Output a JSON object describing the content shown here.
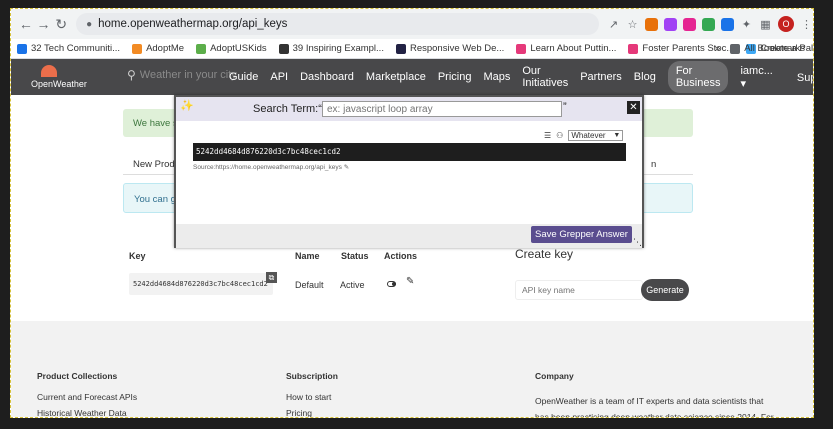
{
  "browser": {
    "url": "home.openweathermap.org/api_keys",
    "bookmarks": [
      {
        "label": "32 Tech Communiti...",
        "color": "#1a73e8"
      },
      {
        "label": "AdoptMe",
        "color": "#f28b24"
      },
      {
        "label": "AdoptUSKids",
        "color": "#5cae4a"
      },
      {
        "label": "39 Inspiring Exampl...",
        "color": "#333333"
      },
      {
        "label": "Responsive Web De...",
        "color": "#222244"
      },
      {
        "label": "Learn About Puttin...",
        "color": "#e5397a"
      },
      {
        "label": "Foster Parents Stoc...",
        "color": "#e5397a"
      },
      {
        "label": "Create a Palette - C...",
        "color": "#3da8f5"
      }
    ],
    "all_bookmarks": "All Bookmarks",
    "avatar_letter": "O"
  },
  "ow": {
    "logo": "OpenWeather",
    "search_placeholder": "Weather in your city",
    "nav": [
      "Guide",
      "API",
      "Dashboard",
      "Marketplace",
      "Pricing",
      "Maps",
      "Our Initiatives",
      "Partners",
      "Blog"
    ],
    "business_button": "For Business",
    "user": "iamc...",
    "support": "Support"
  },
  "page": {
    "success_text": "We have se",
    "tab_left": "New Produ",
    "tab_right": "n",
    "info_text": "You can ge",
    "headers": {
      "key": "Key",
      "name": "Name",
      "status": "Status",
      "actions": "Actions"
    },
    "row": {
      "key": "5242dd4684d876220d3c7bc48cec1cd2",
      "name": "Default",
      "status": "Active"
    },
    "create_title": "Create key",
    "api_key_placeholder": "API key name",
    "generate": "Generate"
  },
  "footer": {
    "col1": {
      "title": "Product Collections",
      "items": [
        "Current and Forecast APIs",
        "Historical Weather Data"
      ]
    },
    "col2": {
      "title": "Subscription",
      "items": [
        "How to start",
        "Pricing"
      ]
    },
    "col3": {
      "title": "Company",
      "text": "OpenWeather is a team of IT experts and data scientists that has been practising deep weather data science since 2014. For each"
    }
  },
  "grepper": {
    "search_label": "Search Term:“",
    "close_quote": "”",
    "search_placeholder": "ex: javascript loop array",
    "language": "Whatever",
    "code": "5242dd4684d876220d3c7bc48cec1cd2",
    "source": "Source:https://home.openweathermap.org/api_keys",
    "save_button": "Save Grepper Answer"
  }
}
